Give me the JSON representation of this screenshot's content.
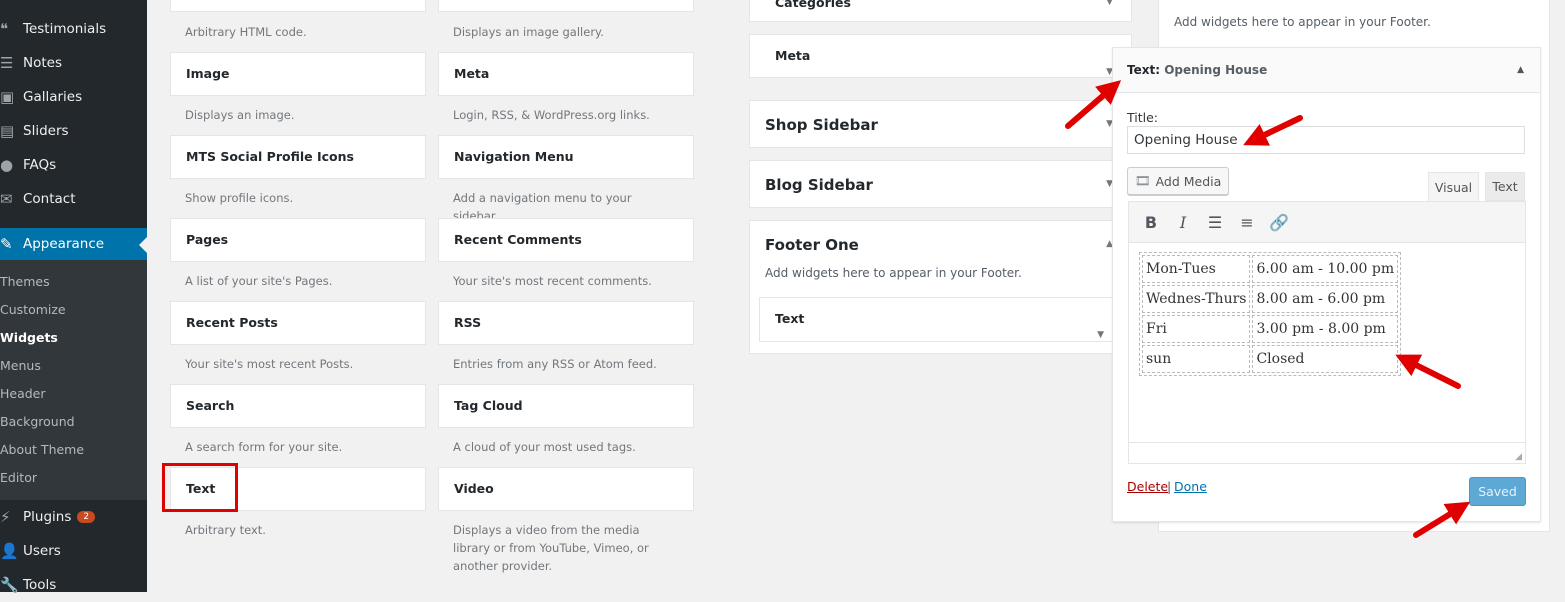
{
  "sidebar": {
    "items": [
      {
        "label": "Testimonials",
        "icon": "testimonials-icon"
      },
      {
        "label": "Notes",
        "icon": "notes-icon"
      },
      {
        "label": "Gallaries",
        "icon": "gallery-icon"
      },
      {
        "label": "Sliders",
        "icon": "sliders-icon"
      },
      {
        "label": "FAQs",
        "icon": "faq-icon"
      },
      {
        "label": "Contact",
        "icon": "mail-icon"
      }
    ],
    "appearance": "Appearance",
    "submenu": [
      "Themes",
      "Customize",
      "Widgets",
      "Menus",
      "Header",
      "Background",
      "About Theme",
      "Editor"
    ],
    "current_sub": "Widgets",
    "plugins": "Plugins",
    "plugins_badge": "2",
    "users": "Users",
    "tools": "Tools"
  },
  "available_widgets": {
    "top_desc": [
      "Arbitrary HTML code.",
      "Displays an image gallery."
    ],
    "rows": [
      [
        {
          "name": "Image",
          "desc": "Displays an image."
        },
        {
          "name": "Meta",
          "desc": "Login, RSS, & WordPress.org links."
        }
      ],
      [
        {
          "name": "MTS Social Profile Icons",
          "desc": "Show profile icons."
        },
        {
          "name": "Navigation Menu",
          "desc": "Add a navigation menu to your sidebar."
        }
      ],
      [
        {
          "name": "Pages",
          "desc": "A list of your site's Pages."
        },
        {
          "name": "Recent Comments",
          "desc": "Your site's most recent comments."
        }
      ],
      [
        {
          "name": "Recent Posts",
          "desc": "Your site's most recent Posts."
        },
        {
          "name": "RSS",
          "desc": "Entries from any RSS or Atom feed."
        }
      ],
      [
        {
          "name": "Search",
          "desc": "A search form for your site."
        },
        {
          "name": "Tag Cloud",
          "desc": "A cloud of your most used tags."
        }
      ],
      [
        {
          "name": "Text",
          "desc": "Arbitrary text."
        },
        {
          "name": "Video",
          "desc": "Displays a video from the media library or from YouTube, Vimeo, or another provider."
        }
      ]
    ]
  },
  "sidebars": {
    "categories": "Categories",
    "meta": "Meta",
    "shop": "Shop Sidebar",
    "blog": "Blog Sidebar",
    "footer_one": "Footer One",
    "footer_one_desc": "Add widgets here to appear in your Footer.",
    "footer_one_widget": "Text",
    "footer_two_desc": "Add widgets here to appear in your Footer."
  },
  "editor": {
    "header_type": "Text:",
    "header_title": "Opening House",
    "title_label": "Title:",
    "title_value": "Opening House",
    "add_media": "Add Media",
    "tab_visual": "Visual",
    "tab_text": "Text",
    "table": [
      [
        "Mon-Tues",
        "6.00 am - 10.00 pm"
      ],
      [
        "Wednes-Thurs",
        "8.00 am - 6.00 pm"
      ],
      [
        "Fri",
        "3.00 pm - 8.00 pm"
      ],
      [
        "sun",
        "Closed"
      ]
    ],
    "delete": "Delete",
    "separator": "|",
    "done": "Done",
    "saved": "Saved"
  },
  "colors": {
    "sidebar_bg": "#23282d",
    "accent": "#0073aa",
    "annotation": "#e00000",
    "saved_button": "#3c9ad0"
  }
}
